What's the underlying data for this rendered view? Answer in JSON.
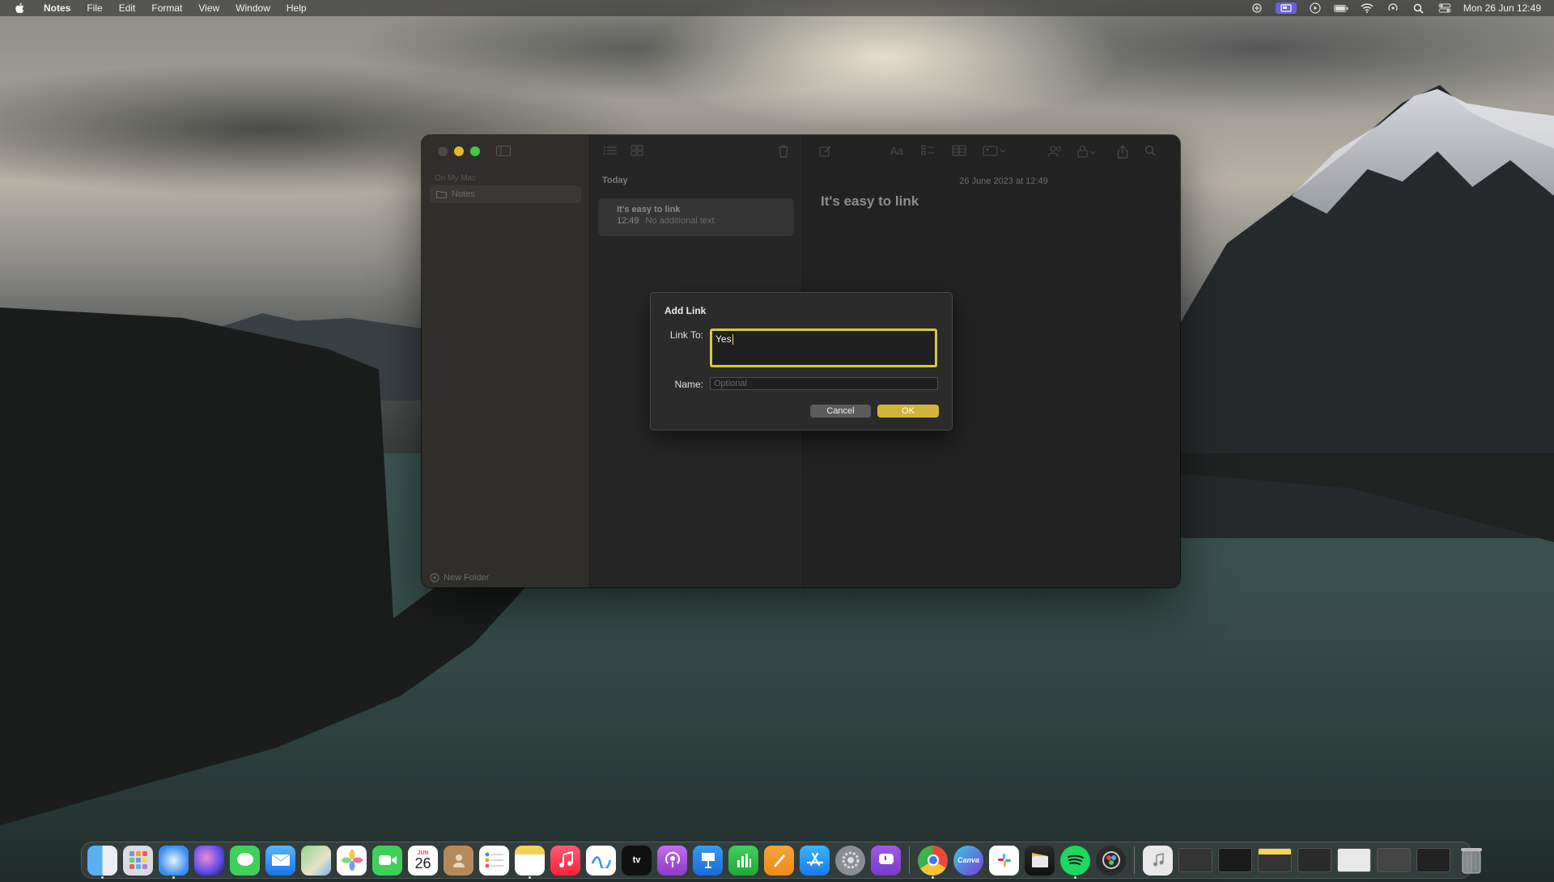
{
  "menubar": {
    "app_name": "Notes",
    "items": [
      "File",
      "Edit",
      "Format",
      "View",
      "Window",
      "Help"
    ],
    "clock": "Mon 26 Jun  12:49",
    "status_icons": [
      "cloud-sync-icon",
      "screen-mirroring-icon",
      "play-icon",
      "battery-icon",
      "wifi-icon",
      "airdrop-icon",
      "search-icon",
      "control-center-icon"
    ]
  },
  "sidebar": {
    "section": "On My Mac",
    "folder": "Notes",
    "new_folder": "New Folder"
  },
  "note_list": {
    "header": "Today",
    "notes": [
      {
        "title": "It's easy to link",
        "time": "12:49",
        "preview": "No additional text"
      }
    ]
  },
  "editor": {
    "date": "26 June 2023 at 12:49",
    "title": "It's easy to link"
  },
  "dialog": {
    "title": "Add Link",
    "link_label": "Link To:",
    "link_value": "Yes",
    "name_label": "Name:",
    "name_placeholder": "Optional",
    "cancel_label": "Cancel",
    "ok_label": "OK"
  },
  "dock": {
    "calendar_month": "JUN",
    "calendar_day": "26",
    "tv_label": "tv",
    "canva_label": "Canva",
    "apps": [
      "finder",
      "launchpad",
      "safari",
      "siri",
      "messages",
      "mail",
      "maps",
      "photos",
      "facetime",
      "calendar",
      "contacts",
      "reminders",
      "notes",
      "music",
      "freeform",
      "tv",
      "podcasts",
      "keynote",
      "numbers",
      "pages",
      "app-store",
      "system-settings",
      "feedback",
      "chrome",
      "canva",
      "slack",
      "final-cut",
      "spotify",
      "davinci"
    ]
  },
  "colors": {
    "accent_yellow": "#d2b43a",
    "focus_ring": "#d6c93b",
    "window_bg": "#2a2a2a"
  }
}
